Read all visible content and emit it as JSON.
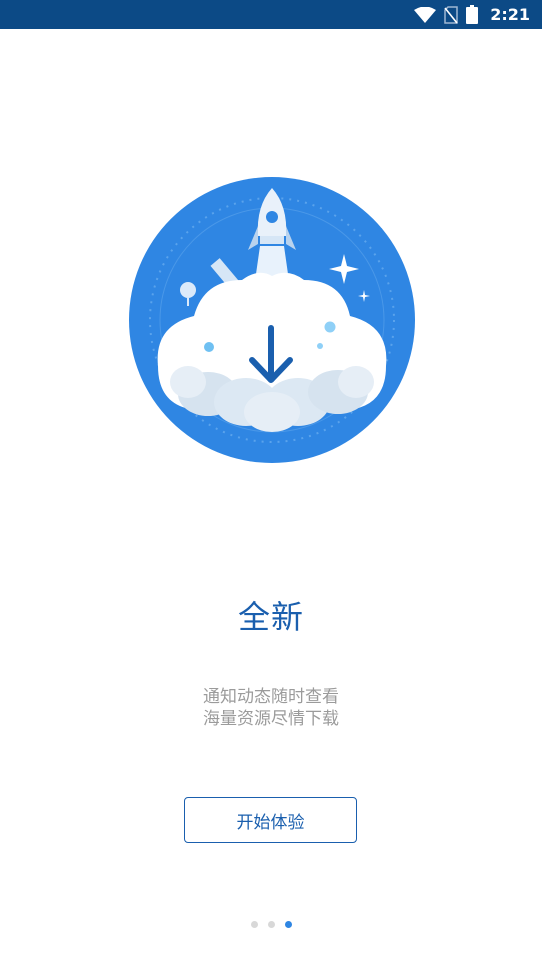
{
  "status_bar": {
    "time": "2:21",
    "icons": [
      "wifi-icon",
      "no-sim-icon",
      "battery-icon"
    ],
    "background": "#0c4a86"
  },
  "hero": {
    "illustration": "rocket-cloud-download-illustration",
    "circle_color": "#2f86e3"
  },
  "onboarding": {
    "title": "全新",
    "desc_line1": "通知动态随时查看",
    "desc_line2": "海量资源尽情下载",
    "start_label": "开始体验",
    "accent_color": "#1a5fae"
  },
  "pager": {
    "total": 3,
    "active_index": 3
  }
}
